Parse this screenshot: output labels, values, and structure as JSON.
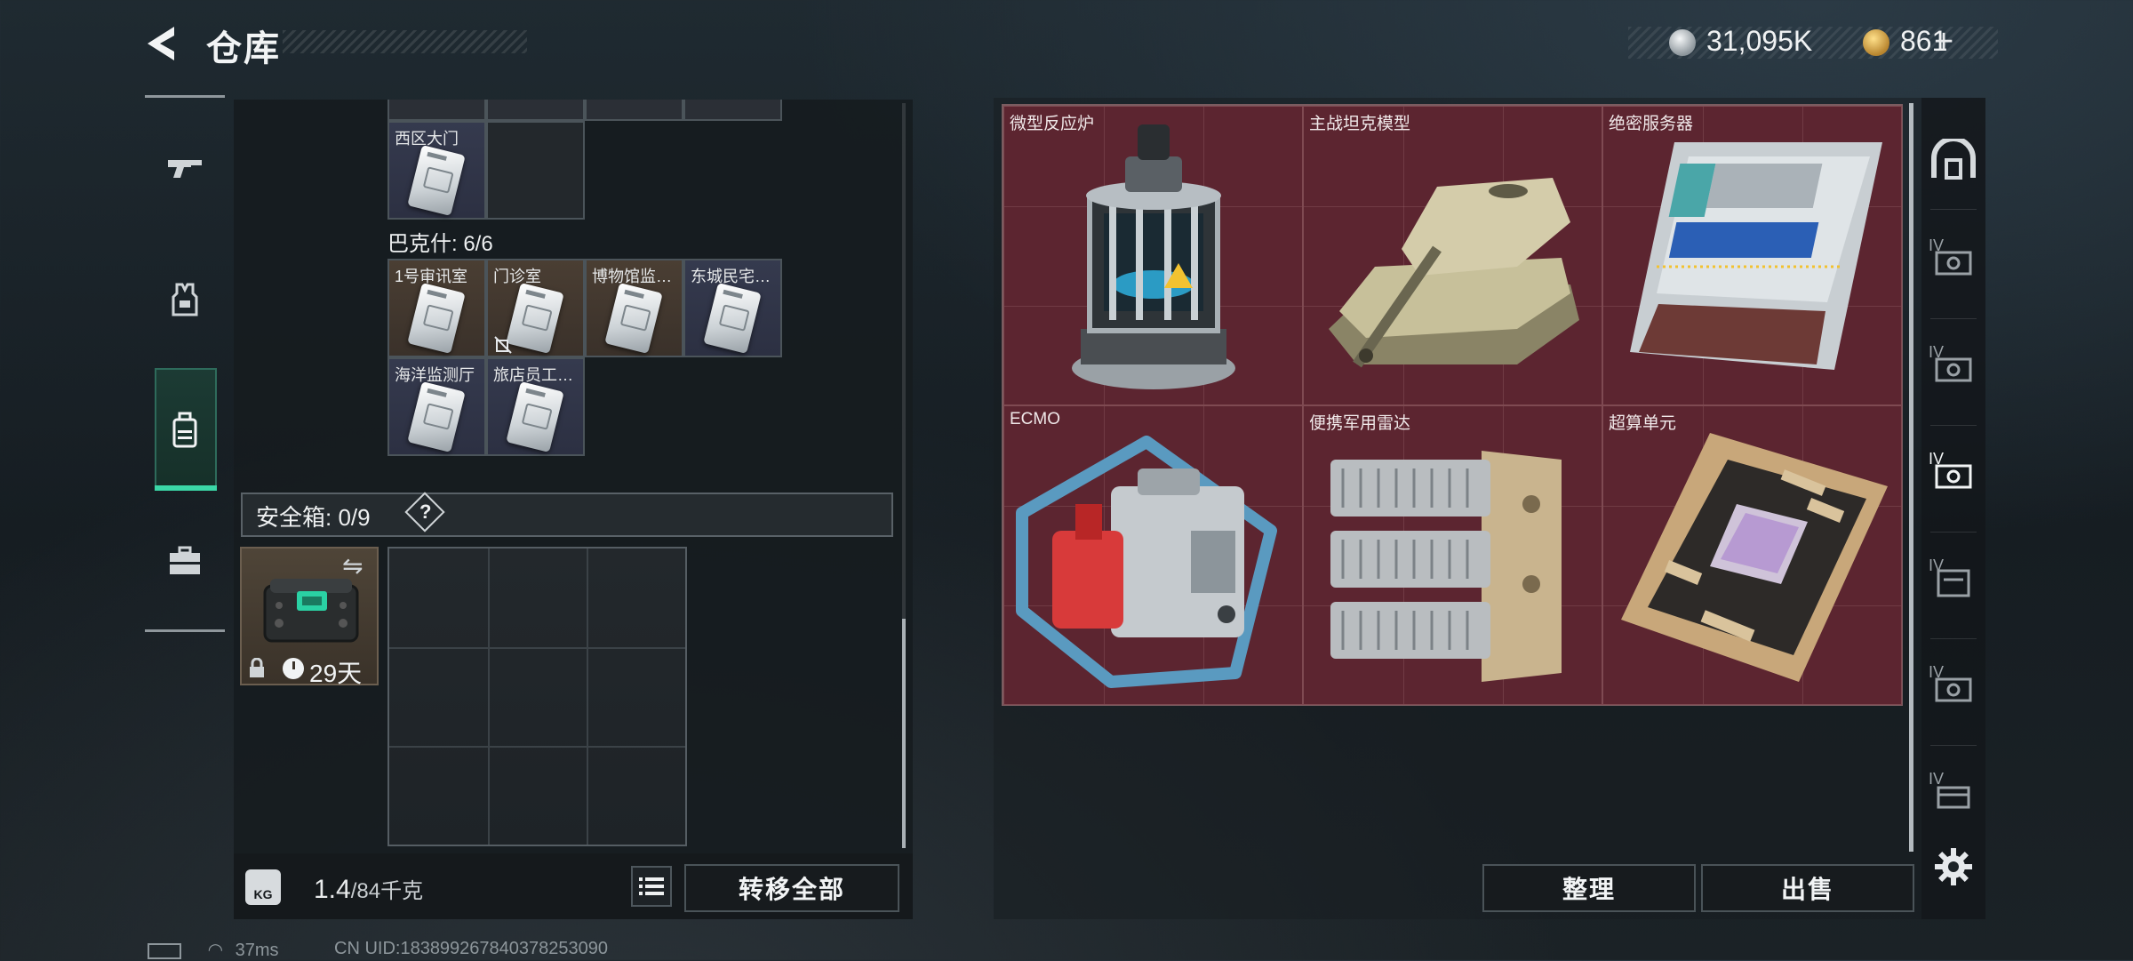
{
  "header": {
    "title": "仓库",
    "back_icon": "back-arrow-icon",
    "currency_silver": "31,095K",
    "currency_gold": "861",
    "plus": "+"
  },
  "left_rail": {
    "items": [
      {
        "icon": "gun-icon"
      },
      {
        "icon": "armor-vest-icon"
      },
      {
        "icon": "backpack-icon",
        "active": true
      },
      {
        "icon": "toolbox-icon"
      }
    ]
  },
  "inventory": {
    "top_cell_label": "西区大门",
    "group_title": "巴克什: 6/6",
    "keys": [
      {
        "label": "1号审讯室",
        "tone": "brown"
      },
      {
        "label": "门诊室",
        "tone": "brown"
      },
      {
        "label": "博物馆监…",
        "tone": "brown"
      },
      {
        "label": "东城民宅…",
        "tone": "blue"
      },
      {
        "label": "海洋监测厅",
        "tone": "blue"
      },
      {
        "label": "旅店员工…",
        "tone": "blue"
      }
    ],
    "safe_label": "安全箱: 0/9",
    "safe_help": "?",
    "safe_days": "29天",
    "weight_value": "1.4",
    "weight_max": "/84千克",
    "kg_badge": "KG",
    "transfer_all": "转移全部"
  },
  "stash": {
    "items": [
      {
        "name": "微型反应炉"
      },
      {
        "name": "主战坦克模型"
      },
      {
        "name": "绝密服务器"
      },
      {
        "name": "ECMO"
      },
      {
        "name": "便携军用雷达"
      },
      {
        "name": "超算单元"
      }
    ],
    "tier_label": "IV",
    "organize": "整理",
    "sell": "出售",
    "colors": {
      "highlight_bg": "#5c2530",
      "active_accent": "#3bd7a7"
    }
  },
  "status": {
    "ping": "37ms",
    "uid": "CN UID:1838992678403782530​90"
  }
}
